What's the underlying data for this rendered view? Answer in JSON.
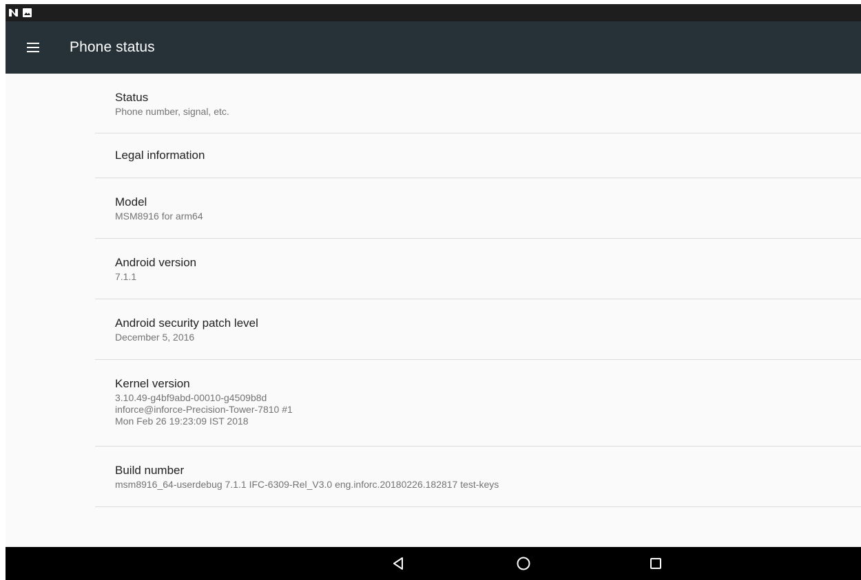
{
  "status_bar": {
    "icons": [
      "n-notification-icon",
      "image-notification-icon"
    ]
  },
  "app_bar": {
    "title": "Phone status",
    "menu_icon": "hamburger-menu-icon"
  },
  "preferences": [
    {
      "title": "Status",
      "summary": "Phone number, signal, etc."
    },
    {
      "title": "Legal information",
      "summary": ""
    },
    {
      "title": "Model",
      "summary": "MSM8916 for arm64"
    },
    {
      "title": "Android version",
      "summary": "7.1.1"
    },
    {
      "title": "Android security patch level",
      "summary": "December 5, 2016"
    },
    {
      "title": "Kernel version",
      "summary": "3.10.49-g4bf9abd-00010-g4509b8d\ninforce@inforce-Precision-Tower-7810 #1\nMon Feb 26 19:23:09 IST 2018"
    },
    {
      "title": "Build number",
      "summary": "msm8916_64-userdebug 7.1.1 IFC-6309-Rel_V3.0 eng.inforc.20180226.182817 test-keys"
    }
  ],
  "nav_bar": {
    "icons": [
      "back-icon",
      "home-icon",
      "recents-icon"
    ]
  },
  "colors": {
    "app_bar": "#263238",
    "status_bar": "#1e1e1e",
    "nav_bar": "#000000",
    "background": "#fafafa",
    "divider": "#dcdcdc",
    "title_text": "#212121",
    "summary_text": "#737373"
  }
}
